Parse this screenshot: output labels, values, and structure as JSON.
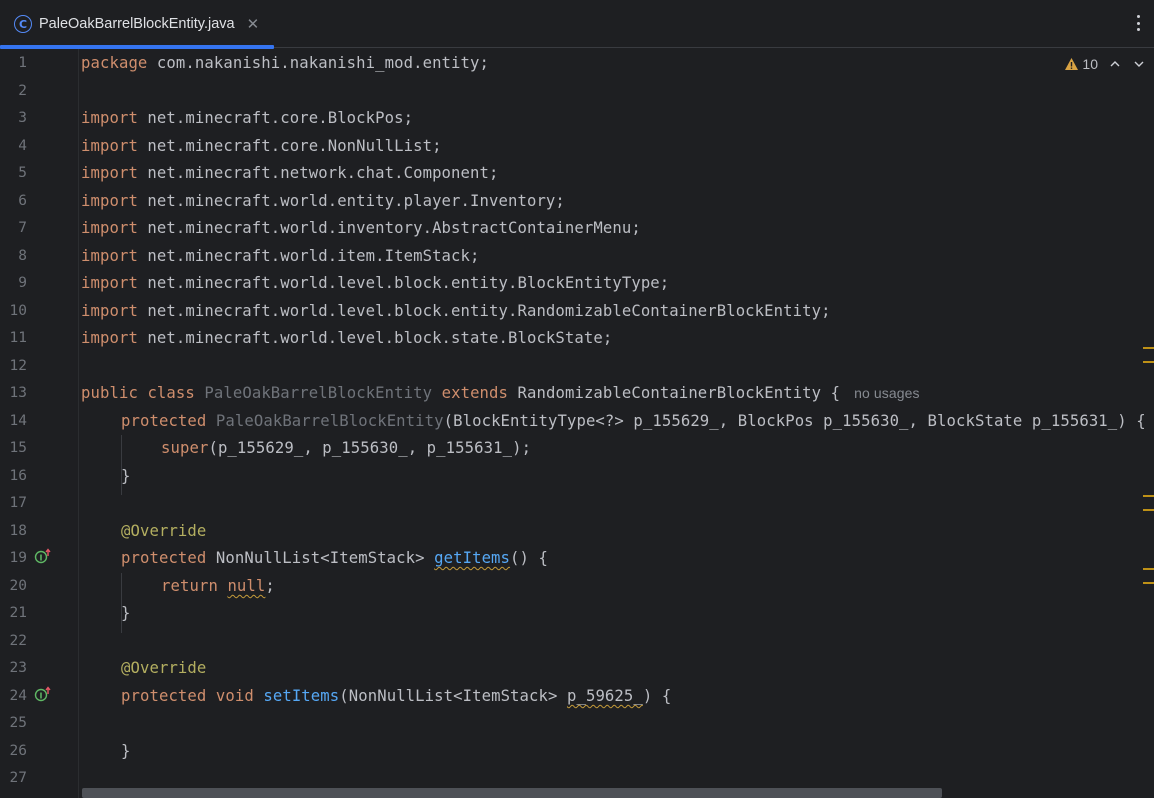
{
  "tab": {
    "icon": "java-class-icon",
    "icon_glyph": "C",
    "title": "PaleOakBarrelBlockEntity.java",
    "close_glyph": "✕"
  },
  "inspection": {
    "warnings_count": "10"
  },
  "line_numbers": [
    "1",
    "2",
    "3",
    "4",
    "5",
    "6",
    "7",
    "8",
    "9",
    "10",
    "11",
    "12",
    "13",
    "14",
    "15",
    "16",
    "17",
    "18",
    "19",
    "20",
    "21",
    "22",
    "23",
    "24",
    "25",
    "26",
    "27"
  ],
  "code": {
    "l1": {
      "kw": "package",
      "rest": " com.nakanishi.nakanishi_mod.entity;"
    },
    "imports": [
      {
        "kw": "import",
        "rest": " net.minecraft.core.BlockPos;"
      },
      {
        "kw": "import",
        "rest": " net.minecraft.core.NonNullList;"
      },
      {
        "kw": "import",
        "rest": " net.minecraft.network.chat.Component;"
      },
      {
        "kw": "import",
        "rest": " net.minecraft.world.entity.player.Inventory;"
      },
      {
        "kw": "import",
        "rest": " net.minecraft.world.inventory.AbstractContainerMenu;"
      },
      {
        "kw": "import",
        "rest": " net.minecraft.world.item.ItemStack;"
      },
      {
        "kw": "import",
        "rest": " net.minecraft.world.level.block.entity.BlockEntityType;"
      },
      {
        "kw": "import",
        "rest": " net.minecraft.world.level.block.entity.RandomizableContainerBlockEntity;"
      },
      {
        "kw": "import",
        "rest": " net.minecraft.world.level.block.state.BlockState;"
      }
    ],
    "l13": {
      "kw1": "public",
      "kw2": "class",
      "name": "PaleOakBarrelBlockEntity",
      "kw3": "extends",
      "parent": "RandomizableContainerBlockEntity",
      "brace": " {",
      "hint": "no usages"
    },
    "l14": {
      "kw": "protected",
      "name": "PaleOakBarrelBlockEntity",
      "rest": "(BlockEntityType<?> p_155629_, BlockPos p_155630_, BlockState p_155631_) {"
    },
    "l15": {
      "kw": "super",
      "rest": "(p_155629_, p_155630_, p_155631_);"
    },
    "l16": "}",
    "l18": "@Override",
    "l19": {
      "kw": "protected",
      "type": " NonNullList<ItemStack> ",
      "fn": "getItems",
      "rest": "() {"
    },
    "l20": {
      "kw": "return",
      "val": "null",
      "rest": ";"
    },
    "l21": "}",
    "l23": "@Override",
    "l24": {
      "kw1": "protected",
      "kw2": "void",
      "fn": "setItems",
      "params": "(NonNullList<ItemStack> ",
      "param": "p_59625_",
      "rest": ") {"
    },
    "l26": "}"
  },
  "colors": {
    "background": "#1e1f22",
    "keyword": "#cf8e6d",
    "annotation": "#b3ae60",
    "method": "#56a8f5",
    "text": "#bcbec4",
    "accent": "#3574f0",
    "warning": "#d9a343"
  }
}
